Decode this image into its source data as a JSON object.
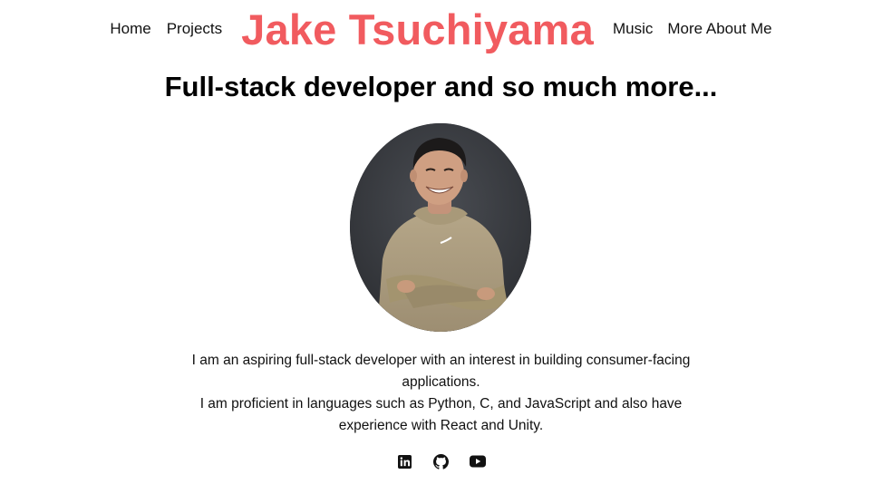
{
  "nav": {
    "left_links": [
      {
        "label": "Home"
      },
      {
        "label": "Projects"
      }
    ],
    "brand": "Jake Tsuchiyama",
    "right_links": [
      {
        "label": "Music"
      },
      {
        "label": "More About Me"
      }
    ]
  },
  "hero": {
    "headline": "Full-stack developer and so much more..."
  },
  "bio": {
    "paragraph_1": "I am an aspiring full-stack developer with an interest in building consumer-facing applications.",
    "paragraph_2": "I am proficient in languages such as Python, C, and JavaScript and also have experience with React and Unity."
  },
  "socials": [
    {
      "icon": "linkedin-icon"
    },
    {
      "icon": "github-icon"
    },
    {
      "icon": "youtube-icon"
    }
  ],
  "colors": {
    "brand": "#f15b5f",
    "text": "#111111",
    "background": "#ffffff"
  }
}
